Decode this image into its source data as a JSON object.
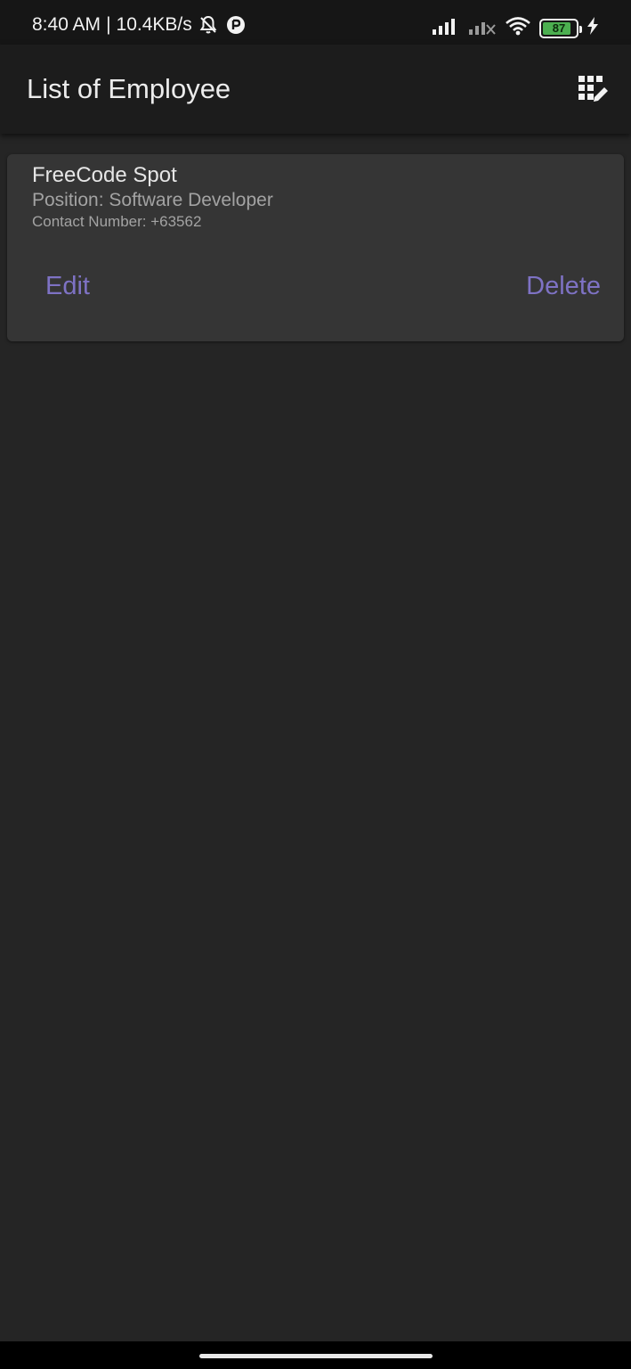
{
  "status_bar": {
    "time": "8:40 AM",
    "separator": "|",
    "net_speed": "10.4KB/s",
    "battery_level": "87",
    "battery_percent": 87,
    "icons": [
      "bell-off-icon",
      "app-notification-icon",
      "signal-icon",
      "signal-off-icon",
      "wifi-icon",
      "battery-icon",
      "charging-icon"
    ],
    "battery_color": "#4caf50"
  },
  "app_bar": {
    "title": "List of Employee",
    "action_icon": "grid-edit-icon"
  },
  "employees": [
    {
      "name": "FreeCode Spot",
      "position": "Position: Software Developer",
      "contact": "Contact Number: +63562",
      "edit_label": "Edit",
      "delete_label": "Delete"
    }
  ],
  "colors": {
    "background": "#252525",
    "card": "#353535",
    "accent": "#7e72c4"
  }
}
